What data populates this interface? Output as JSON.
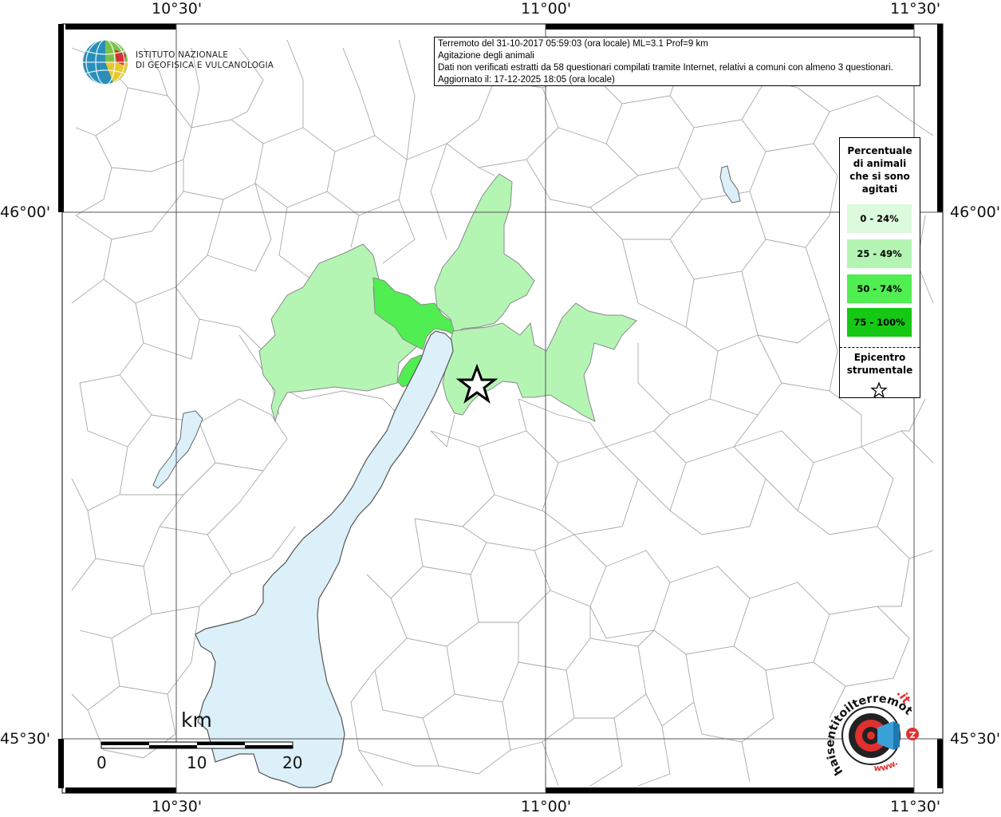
{
  "header": {
    "line1": "Terremoto del 31-10-2017 05:59:03 (ora locale) ML=3.1 Prof=9 km",
    "line2": "Agitazione degli animali",
    "line3": "Dati non verificati estratti da 58 questionari compilati tramite Internet, relativi a comuni con almeno 3 questionari.",
    "line4": "Aggiornato il: 17-12-2025 18:05 (ora locale)"
  },
  "institute": {
    "line1": "ISTITUTO NAZIONALE",
    "line2": "DI GEOFISICA E VULCANOLOGIA"
  },
  "axes": {
    "top": [
      "10°30'",
      "11°00'",
      "11°30'"
    ],
    "bottom": [
      "10°30'",
      "11°00'",
      "11°30'"
    ],
    "left": [
      "46°00'",
      "45°30'"
    ],
    "right": [
      "46°00'",
      "45°30'"
    ]
  },
  "legend": {
    "title": [
      "Percentuale",
      "di animali",
      "che si sono",
      "agitati"
    ],
    "items": [
      {
        "label": "0 - 24%",
        "color": "#dcfadc"
      },
      {
        "label": "25 - 49%",
        "color": "#b4f5b4"
      },
      {
        "label": "50 - 74%",
        "color": "#50ee50"
      },
      {
        "label": "75 - 100%",
        "color": "#14c814"
      }
    ],
    "epicenter": [
      "Epicentro",
      "strumentale"
    ]
  },
  "scale": {
    "unit": "km",
    "ticks": [
      "0",
      "10",
      "20"
    ]
  },
  "logo_text": {
    "hs": "haisentitoilterremoto",
    "it": ".it",
    "www": "www."
  },
  "colors": {
    "lake": "#dcf0fa",
    "border": "#999999",
    "grid": "#555555",
    "frame": "#000000"
  }
}
